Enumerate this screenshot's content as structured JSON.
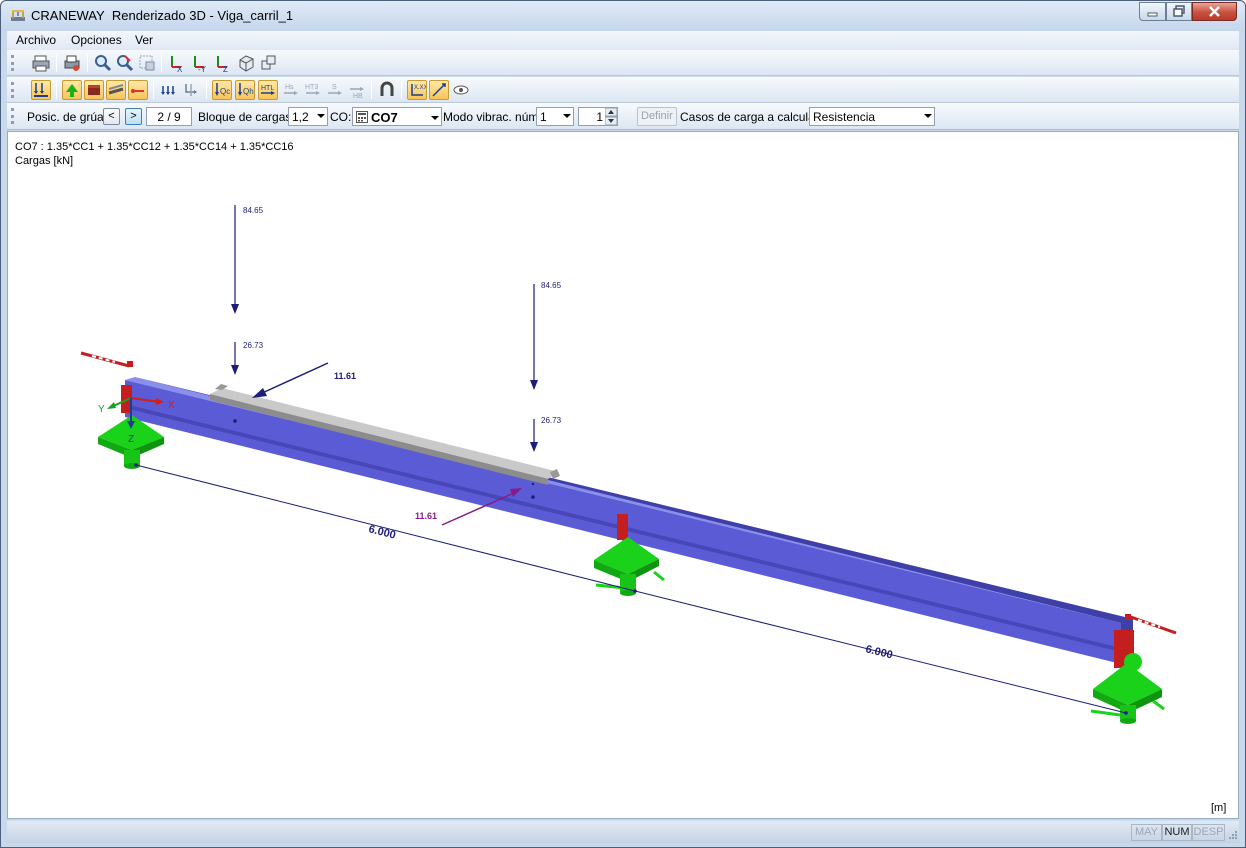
{
  "window": {
    "app_name": "CRANEWAY",
    "title": "Renderizado 3D - Viga_carril_1"
  },
  "menu": {
    "items": [
      "Archivo",
      "Opciones",
      "Ver"
    ]
  },
  "toolbar1": {
    "icons": [
      "print-icon",
      "print-graphic-icon",
      "zoom-icon",
      "zoom-all-icon",
      "zoom-window-icon",
      "view-x-icon",
      "view-minus-y-icon",
      "view-z-icon",
      "isometric-view-icon",
      "multi-view-icon"
    ]
  },
  "toolbar2": {
    "icons": [
      "load-display-icon",
      "support-display-icon",
      "section-display-icon",
      "rail-display-icon",
      "dimension-display-icon",
      "load-values-icon",
      "loads-toggle-icon",
      "qc-load-icon",
      "qh-load-icon",
      "htl-load-icon",
      "hs-load-icon",
      "ht3-load-icon",
      "s-load-icon",
      "hb-load-icon",
      "magnet-icon",
      "axis-icon",
      "values-icon",
      "eye-icon"
    ]
  },
  "control_bar": {
    "crane_position_label": "Posic. de grúa:",
    "prev_button": "<",
    "next_button": ">",
    "crane_position_value": "2 / 9",
    "load_block_label": "Bloque de cargas:",
    "load_block_value": "1,2",
    "co_label": "CO:",
    "co_value": "CO7",
    "vibration_mode_label": "Modo vibrac. núm.",
    "vibration_mode_value": "1",
    "vibration_spinner_value": "1",
    "define_button": "Definir",
    "load_cases_label": "Casos de carga a calcular:",
    "load_cases_value": "Resistencia"
  },
  "viewport": {
    "combination_text": "CO7 : 1.35*CC1 + 1.35*CC12 + 1.35*CC14 + 1.35*CC16",
    "units_text": "Cargas [kN]",
    "unit_label": "[m]",
    "load_labels": {
      "vertical_1_top": "84.65",
      "vertical_1_bottom": "26.73",
      "horizontal_1": "11.61",
      "vertical_2_top": "84.65",
      "vertical_2_bottom": "26.73",
      "horizontal_2": "11.61"
    },
    "dimension_labels": {
      "span_1": "6.000",
      "span_2": "6.000"
    },
    "axis_labels": {
      "x": "X",
      "y": "Y",
      "z": "Z"
    },
    "colors": {
      "beam": "#5b5bd6",
      "rail": "#a9a9a9",
      "support": "#19d219",
      "end_plate": "#c41e1e",
      "load_arrow": "#1c1c7a",
      "horizontal_load_2": "#8a1a8a"
    }
  },
  "status_bar": {
    "caps": "MAY",
    "num": "NUM",
    "scroll": "DESP"
  }
}
